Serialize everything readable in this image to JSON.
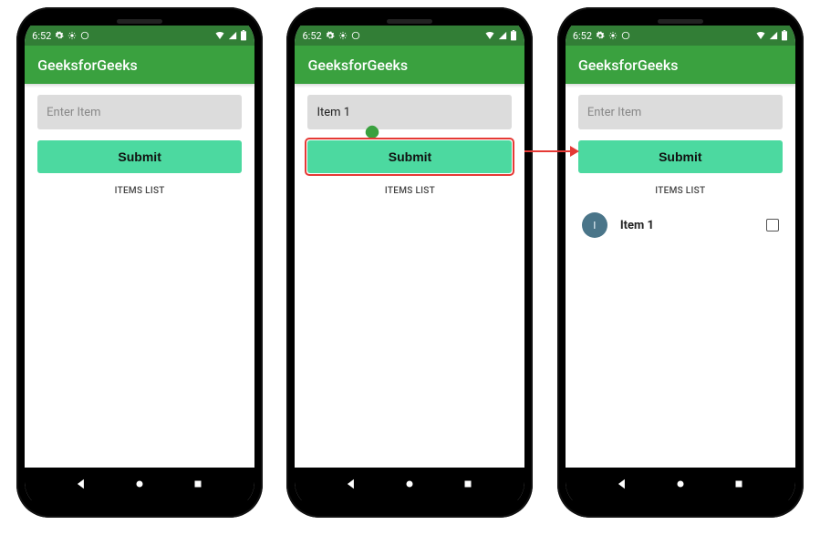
{
  "status": {
    "time": "6:52",
    "icons_left": [
      "gear-icon",
      "sun-icon",
      "sync-icon"
    ],
    "icons_right": [
      "wifi-icon",
      "signal-icon",
      "battery-icon"
    ]
  },
  "appbar": {
    "title": "GeeksforGeeks"
  },
  "input": {
    "placeholder": "Enter Item",
    "filled_value": "Item 1"
  },
  "submit": {
    "label": "Submit"
  },
  "list_header": "ITEMS LIST",
  "list": {
    "items": [
      {
        "avatar": "I",
        "label": "Item 1",
        "checked": false
      }
    ]
  },
  "nav": {
    "back": "back-icon",
    "home": "home-icon",
    "recent": "recent-icon"
  }
}
